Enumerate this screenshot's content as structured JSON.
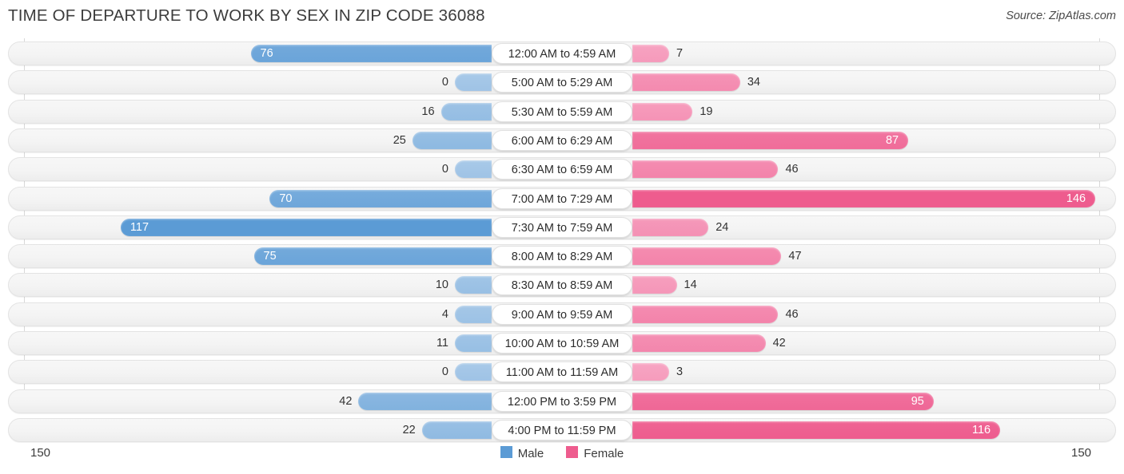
{
  "header": {
    "title": "TIME OF DEPARTURE TO WORK BY SEX IN ZIP CODE 36088",
    "source": "Source: ZipAtlas.com"
  },
  "axis": {
    "left_max": "150",
    "right_max": "150"
  },
  "legend": {
    "items": [
      {
        "label": "Male",
        "color": "#5b9bd5"
      },
      {
        "label": "Female",
        "color": "#ee5c8e"
      }
    ]
  },
  "colors": {
    "male_strong": "#5b9bd5",
    "male_light": "#a8c9e8",
    "female_strong": "#ee5c8e",
    "female_light": "#f7a7c4",
    "track": "#f5f5f5",
    "gridline": "#d8d8d8"
  },
  "chart_data": {
    "type": "bar",
    "orientation": "horizontal-diverging",
    "title": "TIME OF DEPARTURE TO WORK BY SEX IN ZIP CODE 36088",
    "xlabel": "",
    "ylabel": "",
    "xlim": [
      -150,
      150
    ],
    "axis_tick_labels": [
      "150",
      "150"
    ],
    "grid": true,
    "legend_position": "bottom-center",
    "categories": [
      "12:00 AM to 4:59 AM",
      "5:00 AM to 5:29 AM",
      "5:30 AM to 5:59 AM",
      "6:00 AM to 6:29 AM",
      "6:30 AM to 6:59 AM",
      "7:00 AM to 7:29 AM",
      "7:30 AM to 7:59 AM",
      "8:00 AM to 8:29 AM",
      "8:30 AM to 8:59 AM",
      "9:00 AM to 9:59 AM",
      "10:00 AM to 10:59 AM",
      "11:00 AM to 11:59 AM",
      "12:00 PM to 3:59 PM",
      "4:00 PM to 11:59 PM"
    ],
    "series": [
      {
        "name": "Male",
        "color": "#5b9bd5",
        "values": [
          76,
          0,
          16,
          25,
          0,
          70,
          117,
          75,
          10,
          4,
          11,
          0,
          42,
          22
        ]
      },
      {
        "name": "Female",
        "color": "#ee5c8e",
        "values": [
          7,
          34,
          19,
          87,
          46,
          146,
          24,
          47,
          14,
          46,
          42,
          3,
          95,
          116
        ]
      }
    ]
  }
}
